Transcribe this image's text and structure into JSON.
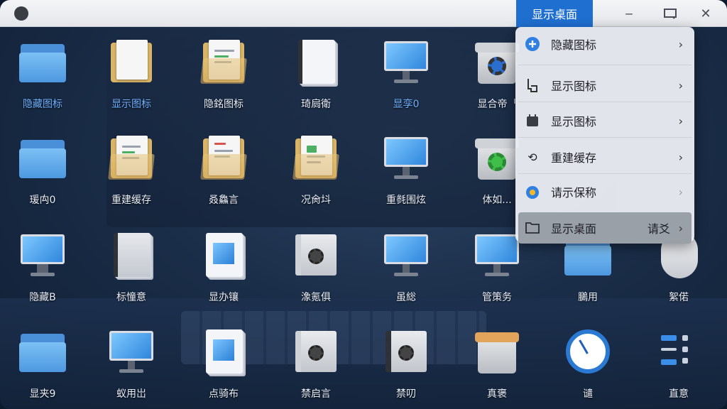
{
  "window": {
    "title_tab": "显示桌面",
    "min_icon": "minimize-icon",
    "restore_icon": "restore-icon",
    "close_icon": "close-icon"
  },
  "grid": {
    "row1": [
      "隐藏图标",
      "显示图标",
      "隐銘图标",
      "琦扃衛",
      "显孪0",
      "显合帝ᅵ"
    ],
    "row2": [
      "瑗禸0",
      "重建缓存",
      "叒鱻言",
      "况肏㘰",
      "重毵围炫",
      "体如..."
    ],
    "row3": [
      "隐藏B",
      "标憧意",
      "显办镶",
      "潒氪俱",
      "虽総",
      "管策务",
      "鵩用",
      "絮偌"
    ],
    "row4": [
      "显夹9",
      "蚁用岀",
      "点骑布",
      "禁启言",
      "禁叨",
      "真褒",
      "谴",
      "直意"
    ]
  },
  "menu": {
    "items": [
      {
        "label": "隐藏图标",
        "icon": "plus-circle-icon"
      },
      {
        "label": "显示图标",
        "icon": "cursor-icon"
      },
      {
        "label": "显示图标",
        "icon": "calendar-icon"
      },
      {
        "label": "重建缓存",
        "icon": "refresh-icon"
      },
      {
        "label": "请示保称",
        "icon": "info-badge-icon"
      },
      {
        "label": "显示桌面",
        "icon": "desktop-icon",
        "extra": "请爻"
      }
    ]
  }
}
